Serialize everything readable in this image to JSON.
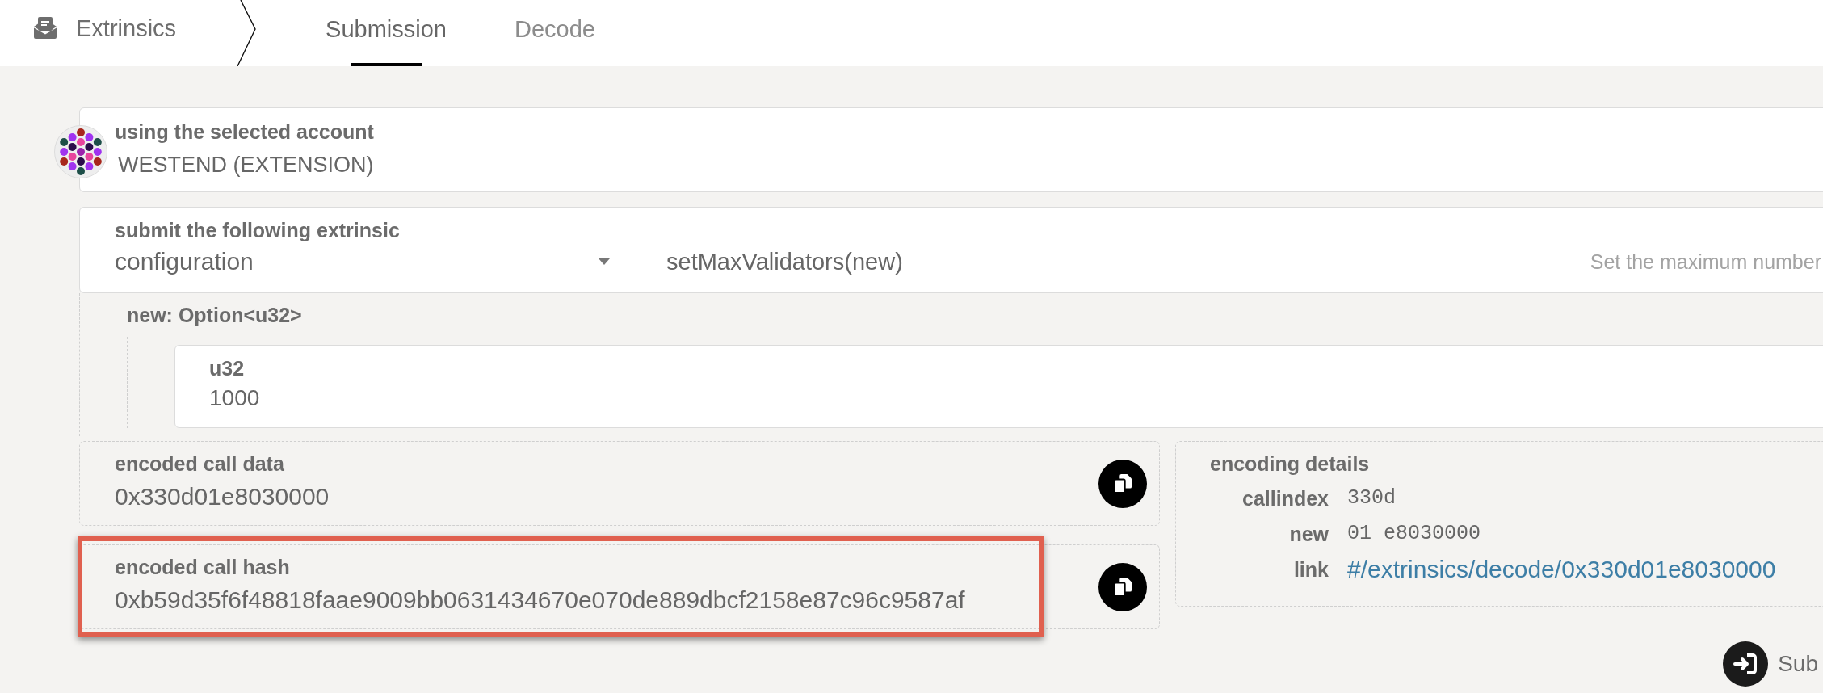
{
  "header": {
    "title": "Extrinsics",
    "tabs": [
      {
        "label": "Submission",
        "selected": true
      },
      {
        "label": "Decode",
        "selected": false
      }
    ]
  },
  "account": {
    "label": "using the selected account",
    "name": "WESTEND (EXTENSION)"
  },
  "extrinsic": {
    "label": "submit the following extrinsic",
    "section": "configuration",
    "method": "setMaxValidators(new)",
    "description": "Set the maximum number"
  },
  "params": [
    {
      "label": "new: Option<u32>",
      "children": [
        {
          "label": "u32",
          "value": "1000"
        }
      ]
    }
  ],
  "encoded": [
    {
      "label": "encoded call data",
      "value": "0x330d01e8030000",
      "highlighted": false
    },
    {
      "label": "encoded call hash",
      "value": "0xb59d35f6f48818faae9009bb0631434670e070de889dbcf2158e87c96c9587af",
      "highlighted": true
    }
  ],
  "encoding_details": {
    "title": "encoding details",
    "rows": [
      {
        "key": "callindex",
        "value": "330d",
        "kind": "code"
      },
      {
        "key": "new",
        "value": "01 e8030000",
        "kind": "code"
      },
      {
        "key": "link",
        "value": "#/extrinsics/decode/0x330d01e8030000",
        "kind": "link"
      }
    ]
  },
  "submit": {
    "label": "Sub"
  }
}
